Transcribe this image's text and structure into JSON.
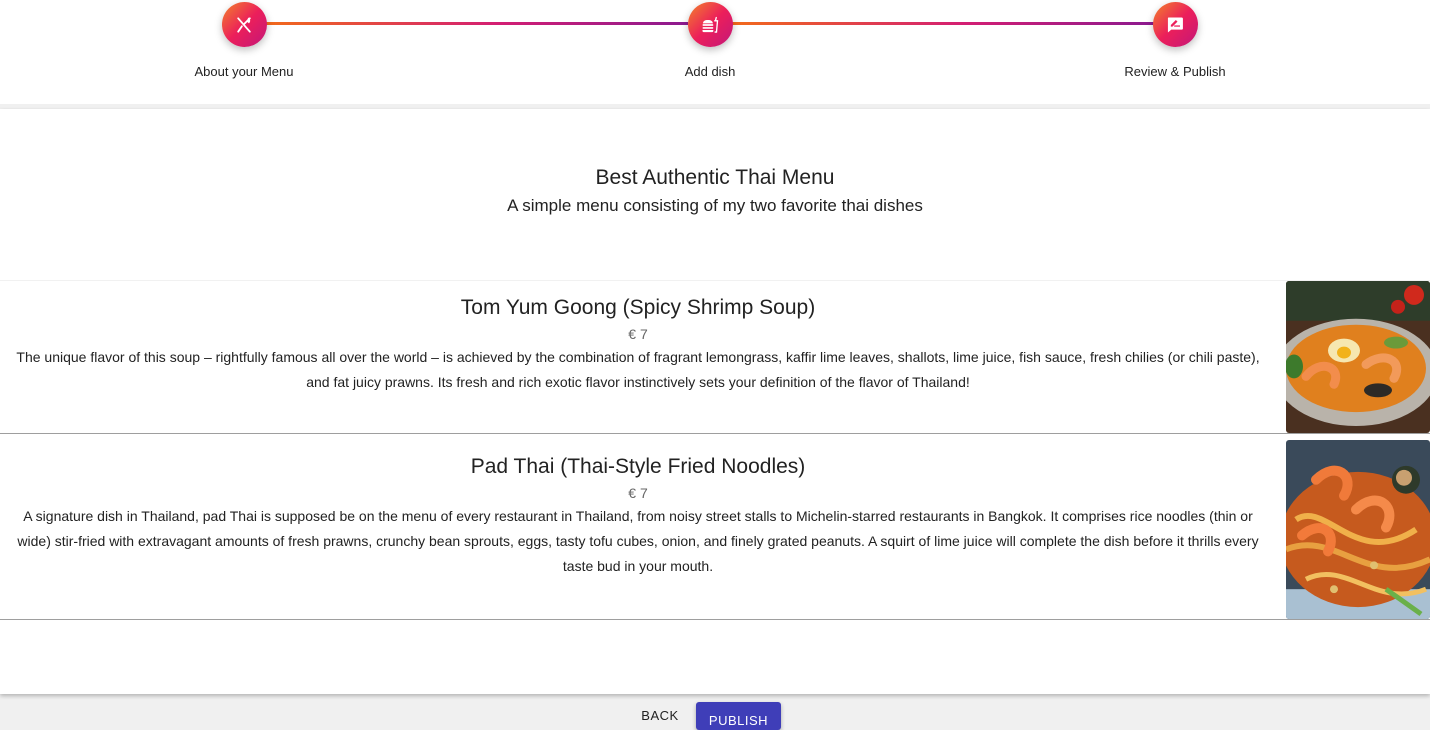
{
  "stepper": {
    "steps": [
      {
        "label": "About your Menu",
        "icon": "utensils-icon"
      },
      {
        "label": "Add dish",
        "icon": "fast-food-icon"
      },
      {
        "label": "Review & Publish",
        "icon": "rate-review-icon"
      }
    ],
    "colors": {
      "gradient_start": "#f2842a",
      "gradient_mid": "#ec1f5a",
      "gradient_end": "#8b1a8f"
    }
  },
  "menu": {
    "title": "Best Authentic Thai Menu",
    "subtitle": "A simple menu consisting of my two favorite thai dishes",
    "dishes": [
      {
        "name": "Tom Yum Goong (Spicy Shrimp Soup)",
        "price": "€ 7",
        "description": "The unique flavor of this soup – rightfully famous all over the world – is achieved by the combination of fragrant lemongrass, kaffir lime leaves, shallots, lime juice, fish sauce, fresh chilies (or chili paste), and fat juicy prawns. Its fresh and rich exotic flavor instinctively sets your definition of the flavor of Thailand!",
        "photo": "tom-yum-soup-photo"
      },
      {
        "name": "Pad Thai (Thai-Style Fried Noodles)",
        "price": "€ 7",
        "description": "A signature dish in Thailand, pad Thai is supposed be on the menu of every restaurant in Thailand, from noisy street stalls to Michelin-starred restaurants in Bangkok. It comprises rice noodles (thin or wide) stir-fried with extravagant amounts of fresh prawns, crunchy bean sprouts, eggs, tasty tofu cubes, onion, and finely grated peanuts. A squirt of lime juice will complete the dish before it thrills every taste bud in your mouth.",
        "photo": "pad-thai-photo"
      }
    ]
  },
  "actions": {
    "back_label": "BACK",
    "publish_label": "PUBLISH",
    "publish_color": "#3f3eb8"
  }
}
